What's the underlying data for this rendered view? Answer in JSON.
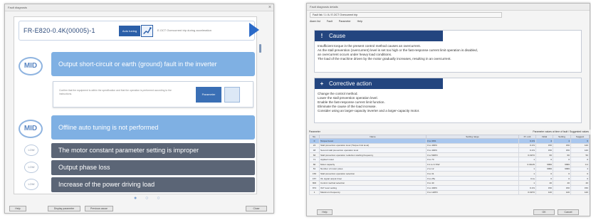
{
  "left_window": {
    "title": "Fault diagnosis",
    "code": "FR-E820-0.4K(00005)-1",
    "tag_label": "Auto tuning",
    "tag_desc": "E.OCT Overcurrent trip during acceleration",
    "detail_text": "Confirm that the equipment is within the specification and that the operation is performed according to the instructions.",
    "detail_button": "Parameter",
    "causes": [
      {
        "severity": "MID",
        "text": "Output short-circuit or earth (ground) fault in the inverter"
      },
      {
        "severity": "MID",
        "text": "Offline auto tuning is not performed"
      },
      {
        "severity": "LOW",
        "text": "The motor constant parameter setting is improper"
      },
      {
        "severity": "LOW",
        "text": "Output phase loss"
      },
      {
        "severity": "LOW",
        "text": "Increase of the power driving load"
      }
    ],
    "pagination": "● ○ ○",
    "footer_buttons": [
      "Help",
      "Display parameter",
      "Previous cause",
      "Close"
    ]
  },
  "right_window": {
    "title": "Fault diagnosis details",
    "toolbar": "Fault list / 1 / A / E.OCT   Overcurrent trip",
    "menu": [
      "Alarm list",
      "Fault",
      "Parameter",
      "Help"
    ],
    "cause": {
      "heading": "Cause",
      "icon": "!",
      "lines": [
        "Insufficient torque in the present control method causes an overcurrent.",
        "As the stall prevention (overcurrent) level is set too high or the fast-response current limit operation is disabled,",
        "an overcurrent occurs under heavy load conditions.",
        "The load of the machine driven by the motor gradually increases, resulting in an overcurrent."
      ]
    },
    "action": {
      "heading": "Corrective action",
      "icon": "+",
      "lines": [
        "Change the control method.",
        "Lower the stall prevention operation level.",
        "Enable the fast-response current limit function.",
        "Eliminate the cause of the load increase.",
        "Consider using an larger-capacity inverter and a larger-capacity motor."
      ]
    },
    "table_bar": {
      "left": "Parameter",
      "right": "Parameter values at time of fault / Suggested values"
    },
    "table": {
      "headers": [
        "No.",
        "Name",
        "Setting range",
        "Pr. unit",
        "Initial",
        "Setting",
        "Suggest"
      ],
      "rows": [
        {
          "no": "0",
          "name": "Torque boost",
          "range": "0 to 30%",
          "unit": "0.1%",
          "init": "4",
          "set": "4",
          "sug": "6",
          "sel": true
        },
        {
          "no": "22",
          "name": "Stall prevention operation level (Torque limit level)",
          "range": "0 to 400%",
          "unit": "0.1%",
          "init": "150",
          "set": "150",
          "sug": "120"
        },
        {
          "no": "48",
          "name": "Second stall prevention operation level",
          "range": "0 to 400%",
          "unit": "0.1%",
          "init": "150",
          "set": "150",
          "sug": "120"
        },
        {
          "no": "66",
          "name": "Stall prevention operation reduction starting frequency",
          "range": "0 to 590Hz",
          "unit": "0.01Hz",
          "init": "60",
          "set": "60",
          "sug": "50"
        },
        {
          "no": "71",
          "name": "Applied motor",
          "range": "0 to 70",
          "unit": "1",
          "init": "0",
          "set": "0",
          "sug": "0"
        },
        {
          "no": "80",
          "name": "Motor capacity",
          "range": "0.1 to 3.7kW",
          "unit": "0.01kW",
          "init": "9999",
          "set": "9999",
          "sug": "0.4"
        },
        {
          "no": "81",
          "name": "Number of motor poles",
          "range": "2 to 12",
          "unit": "1",
          "init": "9999",
          "set": "9999",
          "sug": "4"
        },
        {
          "no": "156",
          "name": "Stall prevention operation selection",
          "range": "0 to 31",
          "unit": "1",
          "init": "0",
          "set": "0",
          "sug": "0"
        },
        {
          "no": "157",
          "name": "OL signal output timer",
          "range": "0 to 25s",
          "unit": "0.1s",
          "init": "0",
          "set": "0",
          "sug": "0"
        },
        {
          "no": "800",
          "name": "Control method selection",
          "range": "0 to 40",
          "unit": "1",
          "init": "40",
          "set": "40",
          "sug": "20"
        },
        {
          "no": "874",
          "name": "OLT level setting",
          "range": "0 to 400%",
          "unit": "0.1%",
          "init": "150",
          "set": "150",
          "sug": "150"
        },
        {
          "no": "1",
          "name": "Maximum frequency",
          "range": "0 to 120Hz",
          "unit": "0.01Hz",
          "init": "120",
          "set": "120",
          "sug": "120"
        }
      ]
    },
    "footer_buttons": [
      "Help",
      "OK",
      "Cancel"
    ]
  }
}
